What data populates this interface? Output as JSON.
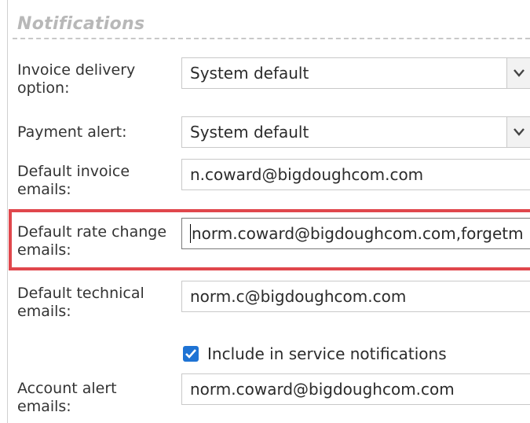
{
  "section": {
    "title": "Notifications"
  },
  "fields": {
    "invoice_delivery": {
      "label": "Invoice delivery option:",
      "value": "System default",
      "arrow_icon": "chevron-down-icon"
    },
    "payment_alert": {
      "label": "Payment alert:",
      "value": "System default",
      "arrow_icon": "chevron-down-icon"
    },
    "default_invoice_emails": {
      "label": "Default invoice emails:",
      "value": "n.coward@bigdoughcom.com"
    },
    "default_rate_change_emails": {
      "label": "Default rate change emails:",
      "value": "norm.coward@bigdoughcom.com,forgetm",
      "highlight_color": "#e0474c"
    },
    "default_technical_emails": {
      "label": "Default technical emails:",
      "value": "norm.c@bigdoughcom.com"
    },
    "service_notifications": {
      "label": "Include in service notifications",
      "checked": true,
      "check_color": "#1e73d4"
    },
    "account_alert_emails": {
      "label": "Account alert emails:",
      "value": "norm.coward@bigdoughcom.com"
    }
  }
}
